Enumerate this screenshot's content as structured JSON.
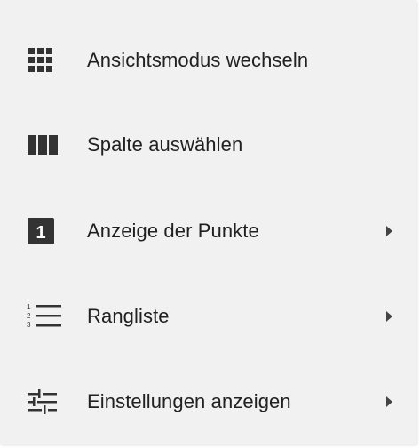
{
  "menu": {
    "items": [
      {
        "label": "Ansichtsmodus wechseln",
        "icon": "grid-view-icon",
        "has_submenu": false
      },
      {
        "label": "Spalte auswählen",
        "icon": "column-view-icon",
        "has_submenu": false
      },
      {
        "label": "Anzeige der Punkte",
        "icon": "number-one-badge-icon",
        "badge_text": "1",
        "has_submenu": true
      },
      {
        "label": "Rangliste",
        "icon": "numbered-list-icon",
        "has_submenu": true
      },
      {
        "label": "Einstellungen anzeigen",
        "icon": "tune-settings-icon",
        "has_submenu": true
      }
    ]
  },
  "colors": {
    "background": "#f1f1f1",
    "text": "#212121",
    "icon": "#333333"
  }
}
